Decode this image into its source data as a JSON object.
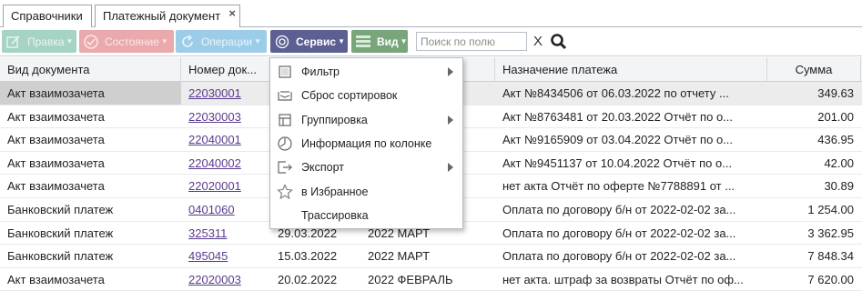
{
  "tabs": [
    {
      "label": "Справочники"
    },
    {
      "label": "Платежный документ",
      "close": "×"
    }
  ],
  "toolbar": {
    "edit": "Правка",
    "state": "Состояние",
    "ops": "Операции",
    "service": "Сервис",
    "view": "Вид",
    "search_placeholder": "Поиск по полю",
    "clear": "X"
  },
  "columns": [
    "Вид документа",
    "Номер док...",
    "",
    "",
    "Назначение платежа",
    "Сумма"
  ],
  "rows": [
    {
      "type": "Акт взаимозачета",
      "num": "22030001",
      "date": "",
      "period": "",
      "purpose": "Акт №8434506 от 06.03.2022 по отчету ...",
      "sum": "349.63"
    },
    {
      "type": "Акт взаимозачета",
      "num": "22030003",
      "date": "",
      "period": "",
      "purpose": "Акт №8763481 от 20.03.2022 Отчёт по о...",
      "sum": "201.00"
    },
    {
      "type": "Акт взаимозачета",
      "num": "22040001",
      "date": "",
      "period": "",
      "purpose": "Акт №9165909 от 03.04.2022 Отчёт по о...",
      "sum": "436.95"
    },
    {
      "type": "Акт взаимозачета",
      "num": "22040002",
      "date": "",
      "period": "",
      "purpose": "Акт №9451137 от 10.04.2022 Отчёт по о...",
      "sum": "42.00"
    },
    {
      "type": "Акт взаимозачета",
      "num": "22020001",
      "date": "",
      "period": "",
      "purpose": "нет акта Отчёт по оферте №7788891 от ...",
      "sum": "30.89"
    },
    {
      "type": "Банковский платеж",
      "num": "0401060",
      "date": "",
      "period": "",
      "purpose": "Оплата по договору б/н от 2022-02-02 за...",
      "sum": "1 254.00"
    },
    {
      "type": "Банковский платеж",
      "num": "325311",
      "date": "29.03.2022",
      "period": "2022 МАРТ",
      "purpose": "Оплата по договору б/н от 2022-02-02 за...",
      "sum": "3 362.95"
    },
    {
      "type": "Банковский платеж",
      "num": "495045",
      "date": "15.03.2022",
      "period": "2022 МАРТ",
      "purpose": "Оплата по договору б/н от 2022-02-02 за...",
      "sum": "7 848.34"
    },
    {
      "type": "Акт взаимозачета",
      "num": "22020003",
      "date": "20.02.2022",
      "period": "2022 ФЕВРАЛЬ",
      "purpose": "нет акта. штраф за возвраты Отчёт по оф...",
      "sum": "7 620.00"
    }
  ],
  "menu": [
    {
      "label": "Фильтр",
      "icon": "filter-icon",
      "submenu": true
    },
    {
      "label": "Сброс сортировок",
      "icon": "reset-sort-icon",
      "submenu": false
    },
    {
      "label": "Группировка",
      "icon": "grouping-icon",
      "submenu": true
    },
    {
      "label": "Информация по колонке",
      "icon": "column-info-icon",
      "submenu": false
    },
    {
      "label": "Экспорт",
      "icon": "export-icon",
      "submenu": true
    },
    {
      "label": "в Избранное",
      "icon": "star-icon",
      "submenu": false
    },
    {
      "label": "Трассировка",
      "icon": "",
      "submenu": false
    }
  ],
  "colors": {
    "edit": "#a5d3c4",
    "state": "#eaa9ad",
    "ops": "#9bcde8",
    "service": "#5b5f91",
    "view": "#78a67a",
    "link": "#5b3b8f"
  }
}
